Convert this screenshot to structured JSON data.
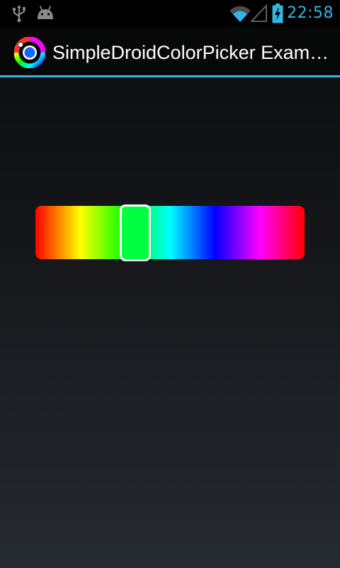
{
  "status_bar": {
    "time": "22:58",
    "icons": [
      "usb-icon",
      "android-icon",
      "wifi-icon",
      "signal-icon",
      "battery-charging-icon"
    ],
    "accent_color": "#33b5e5"
  },
  "action_bar": {
    "title": "SimpleDroidColorPicker Examp…",
    "icon": "color-wheel-icon",
    "divider_color": "#33b5e5"
  },
  "color_picker": {
    "hue_gradient": [
      "#ff0000",
      "#ffff00",
      "#00ff00",
      "#00ffff",
      "#0000ff",
      "#ff00ff",
      "#ff0000"
    ],
    "selected_color": "#00ff40",
    "selected_hue_fraction": 0.36
  }
}
